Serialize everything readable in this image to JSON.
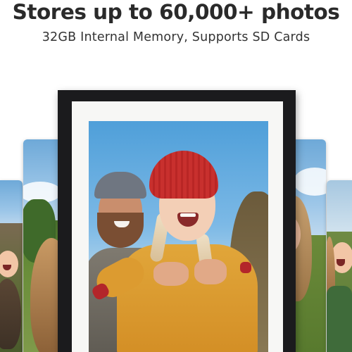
{
  "headline": "Stores up to 60,000+ photos",
  "subheadline": "32GB Internal Memory, Supports SD Cards",
  "colors": {
    "background": "#ffffff",
    "frame": "#1b1b1d",
    "mat": "#f7f7f5",
    "text": "#2a2a2a"
  },
  "images": [
    "family-photo-in-frame",
    "side-photo-girl-smiling",
    "side-photo-woman-grass",
    "side-photo-woman-hair",
    "side-photo-kid-laughing"
  ]
}
